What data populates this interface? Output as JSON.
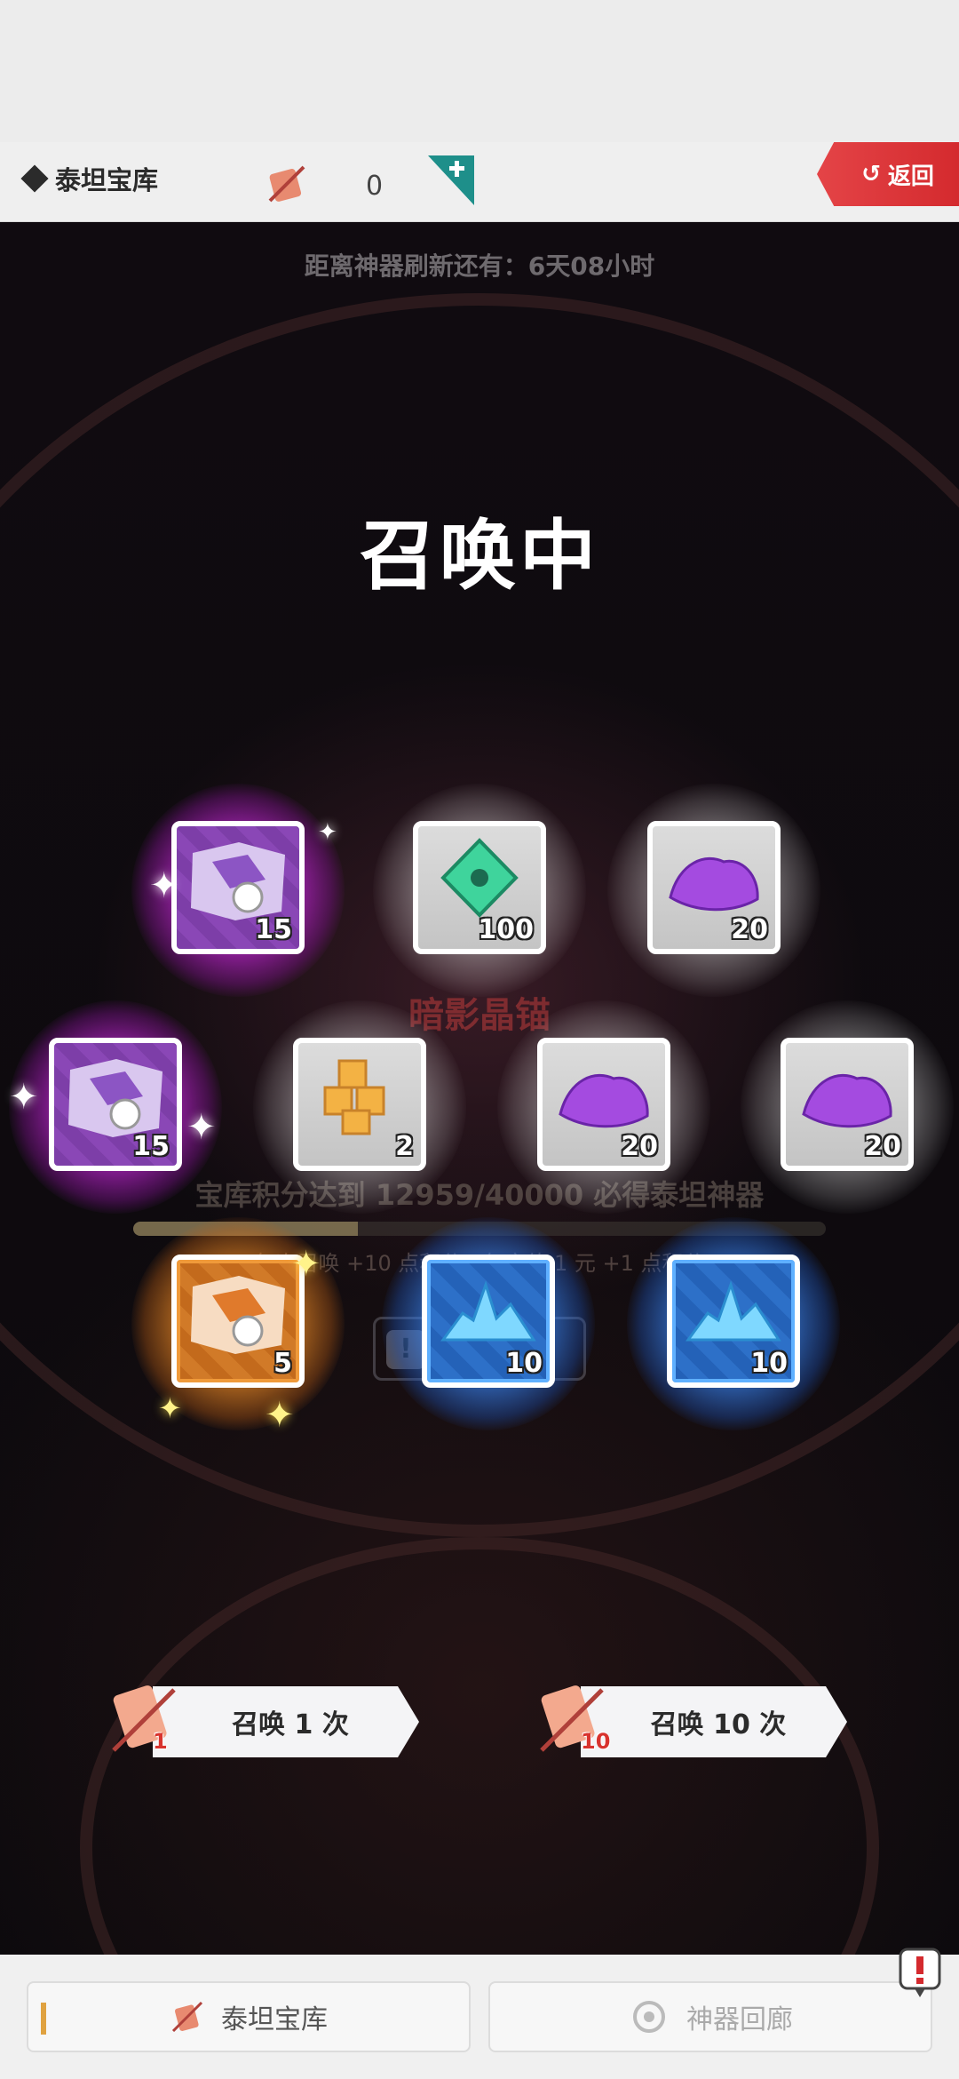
{
  "header": {
    "title": "泰坦宝库",
    "coin_count": "0",
    "back_label": "返回"
  },
  "refresh_notice": "距离神器刷新还有：6天08小时",
  "overlay_title": "召唤中",
  "emblem_name": "暗影晶锚",
  "progress": {
    "text": "宝库积分达到 12959/40000 必得泰坦神器",
    "current": 12959,
    "max": 40000
  },
  "rule_text": "每次召唤 +10 点积分，每充值 1 元 +1 点积分",
  "rewards": [
    {
      "item": "treasure-map",
      "qty": "15",
      "rarity": "purple"
    },
    {
      "item": "green-gem",
      "qty": "100",
      "rarity": "gray"
    },
    {
      "item": "purple-ore",
      "qty": "20",
      "rarity": "gray"
    },
    {
      "item": "treasure-map",
      "qty": "15",
      "rarity": "purple"
    },
    {
      "item": "gold-blocks",
      "qty": "2",
      "rarity": "gray"
    },
    {
      "item": "purple-ore",
      "qty": "20",
      "rarity": "gray"
    },
    {
      "item": "purple-ore",
      "qty": "20",
      "rarity": "gray"
    },
    {
      "item": "treasure-map",
      "qty": "5",
      "rarity": "orange"
    },
    {
      "item": "blue-crystal",
      "qty": "10",
      "rarity": "blue"
    },
    {
      "item": "blue-crystal",
      "qty": "10",
      "rarity": "blue"
    }
  ],
  "summon_buttons": [
    {
      "label": "召唤 1 次",
      "ticket_count": "1"
    },
    {
      "label": "召唤 10 次",
      "ticket_count": "10"
    }
  ],
  "bottom_nav": [
    {
      "label": "泰坦宝库",
      "active": true
    },
    {
      "label": "神器回廊",
      "active": false
    }
  ],
  "colors": {
    "back_button": "#d42a2e",
    "rarity_purple": "#a030c0",
    "rarity_orange": "#e0801c",
    "rarity_blue": "#2d70c8",
    "active_tab_marker": "#e0a240"
  }
}
